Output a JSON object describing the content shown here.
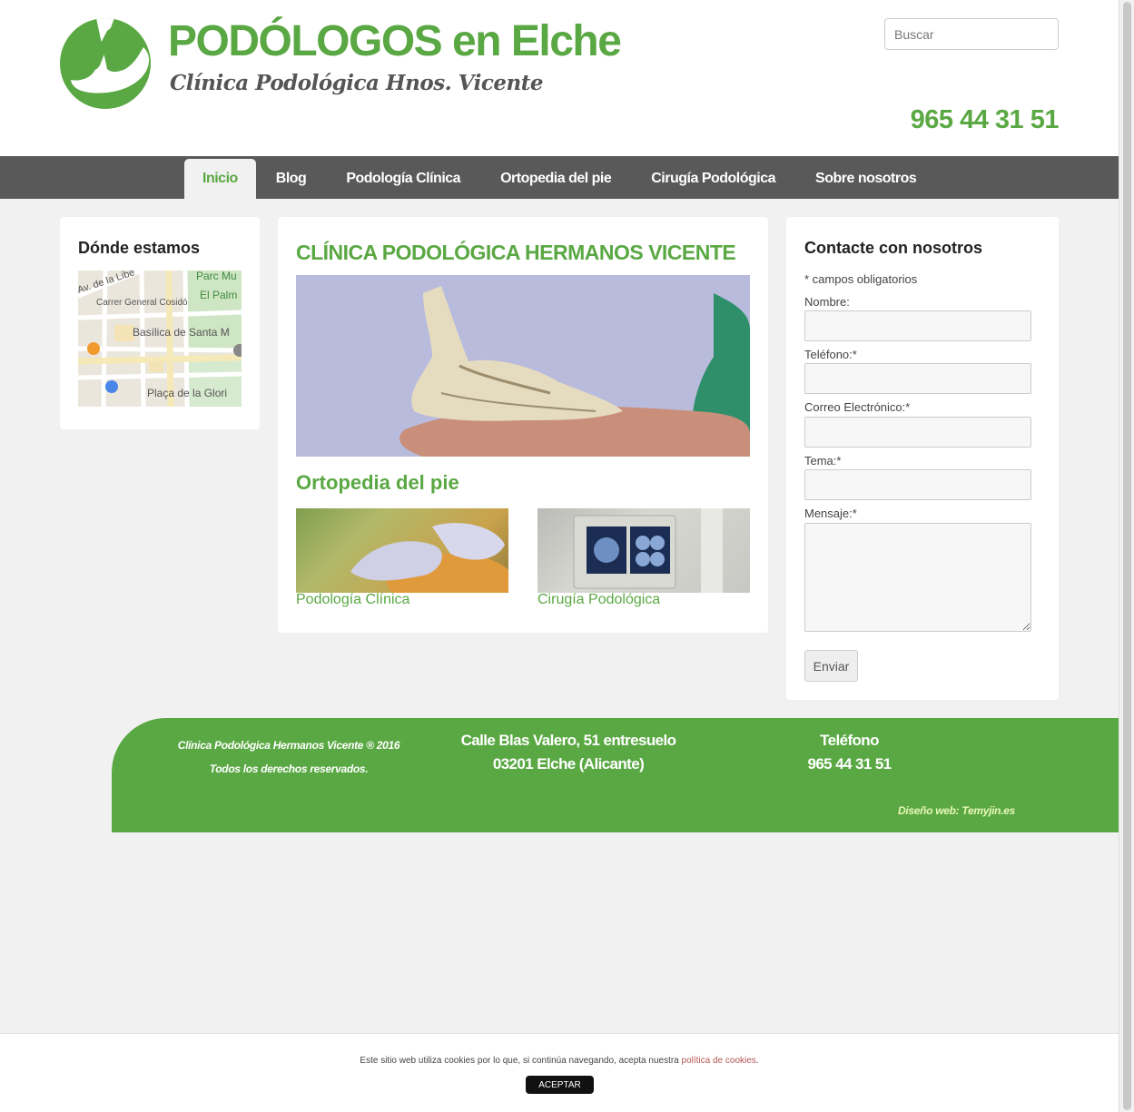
{
  "header": {
    "title": "PODÓLOGOS en Elche",
    "subtitle": "Clínica Podológica Hnos. Vicente",
    "search_placeholder": "Buscar",
    "phone": "965 44 31 51"
  },
  "nav": {
    "items": [
      {
        "label": "Inicio",
        "active": true
      },
      {
        "label": "Blog"
      },
      {
        "label": "Podología Clínica"
      },
      {
        "label": "Ortopedia del pie"
      },
      {
        "label": "Cirugía Podológica"
      },
      {
        "label": "Sobre nosotros"
      }
    ]
  },
  "location": {
    "title": "Dónde estamos",
    "map_labels": [
      "Av. de la Libe",
      "Carrer General Cosidó",
      "Parc Mu",
      "El Palm",
      "Basílica de Santa M",
      "Plaça de la Glori"
    ]
  },
  "main": {
    "title": "CLÍNICA PODOLÓGICA HERMANOS VICENTE",
    "section_title": "Ortopedia del pie",
    "cards": [
      {
        "caption": "Podología Clínica"
      },
      {
        "caption": "Cirugía Podológica"
      }
    ]
  },
  "contact": {
    "title": "Contacte con nosotros",
    "note": "* campos obligatorios",
    "fields": [
      {
        "label": "Nombre:"
      },
      {
        "label": "Teléfono:*"
      },
      {
        "label": "Correo Electrónico:*"
      },
      {
        "label": "Tema:*"
      },
      {
        "label": "Mensaje:*"
      }
    ],
    "submit": "Enviar"
  },
  "footer": {
    "copyright_line1": "Clínica Podológica Hermanos Vicente ® 2016",
    "copyright_line2": "Todos los derechos reservados.",
    "address_line1": "Calle Blas Valero, 51 entresuelo",
    "address_line2": "03201 Elche (Alicante)",
    "phone_label": "Teléfono",
    "phone": "965 44 31 51",
    "design": "Diseño web: Temyjin.es"
  },
  "cookie": {
    "text": "Este sitio web utiliza cookies por lo que, si continúa navegando, acepta nuestra",
    "link": "política de cookies",
    "button": "ACEPTAR"
  },
  "colors": {
    "brand_green": "#5aa843",
    "nav_gray": "#595959"
  }
}
